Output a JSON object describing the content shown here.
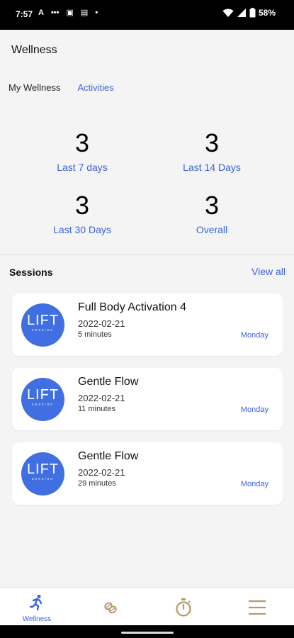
{
  "status_bar": {
    "time": "7:57",
    "battery": "58%",
    "left_icons": [
      "A",
      "•••",
      "▣",
      "▤",
      "•"
    ]
  },
  "header": {
    "title": "Wellness"
  },
  "tabs": [
    {
      "label": "My Wellness"
    },
    {
      "label": "Activities"
    }
  ],
  "stats": [
    {
      "value": "3",
      "label": "Last 7 days"
    },
    {
      "value": "3",
      "label": "Last 14 Days"
    },
    {
      "value": "3",
      "label": "Last 30 Days"
    },
    {
      "value": "3",
      "label": "Overall"
    }
  ],
  "sessions": {
    "title": "Sessions",
    "view_all": "View all",
    "items": [
      {
        "logo_text": "LIFT",
        "logo_subtext": "session",
        "title": "Full Body Activation 4",
        "date": "2022-02-21",
        "duration": "5 minutes",
        "day": "Monday"
      },
      {
        "logo_text": "LIFT",
        "logo_subtext": "session",
        "title": "Gentle Flow",
        "date": "2022-02-21",
        "duration": "11 minutes",
        "day": "Monday"
      },
      {
        "logo_text": "LIFT",
        "logo_subtext": "session",
        "title": "Gentle Flow",
        "date": "2022-02-21",
        "duration": "29 minutes",
        "day": "Monday"
      }
    ]
  },
  "bottom_nav": {
    "items": [
      {
        "icon": "running-person-icon",
        "label": "Wellness",
        "active": true
      },
      {
        "icon": "nutrition-icon",
        "label": ""
      },
      {
        "icon": "stopwatch-icon",
        "label": ""
      },
      {
        "icon": "hamburger-menu-icon",
        "label": ""
      }
    ]
  },
  "colors": {
    "accent": "#3b63d9",
    "logo_blue": "#3f6fe0",
    "page_bg": "#f4f4f4",
    "nav_gold": "#b59a6a"
  }
}
